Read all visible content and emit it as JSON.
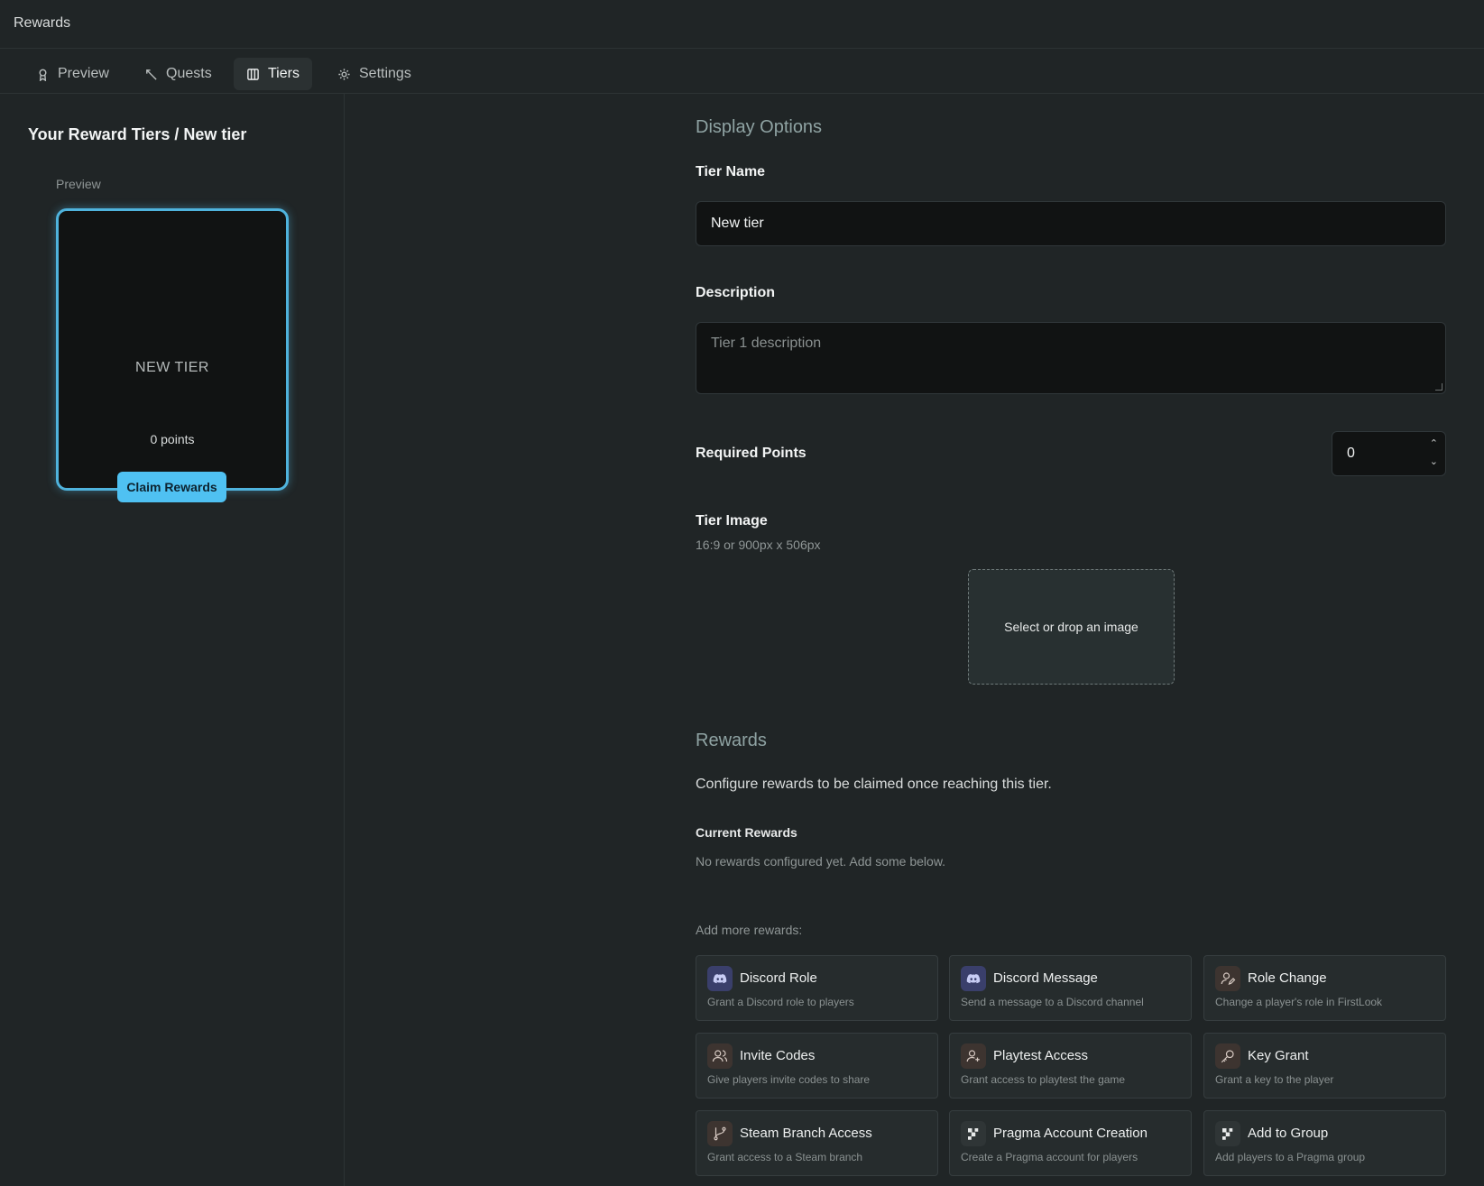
{
  "app": {
    "title": "Rewards"
  },
  "tabs": [
    {
      "label": "Preview",
      "icon": "award-icon",
      "active": false
    },
    {
      "label": "Quests",
      "icon": "wand-icon",
      "active": false
    },
    {
      "label": "Tiers",
      "icon": "columns-icon",
      "active": true
    },
    {
      "label": "Settings",
      "icon": "gear-icon",
      "active": false
    }
  ],
  "sidebar": {
    "breadcrumb": "Your Reward Tiers / New tier",
    "preview_label": "Preview",
    "card": {
      "name": "NEW TIER",
      "points": "0 points",
      "claim_label": "Claim Rewards",
      "accent": "#4fc1f2"
    }
  },
  "form": {
    "display_options_title": "Display Options",
    "tier_name_label": "Tier Name",
    "tier_name_value": "New tier",
    "description_label": "Description",
    "description_placeholder": "Tier 1 description",
    "required_points_label": "Required Points",
    "required_points_value": "0",
    "tier_image_label": "Tier Image",
    "tier_image_hint": "16:9 or 900px x 506px",
    "dropzone_label": "Select or drop an image"
  },
  "rewards": {
    "title": "Rewards",
    "intro": "Configure rewards to be claimed once reaching this tier.",
    "current_label": "Current Rewards",
    "empty_text": "No rewards configured yet. Add some below.",
    "add_more_label": "Add more rewards:",
    "options": [
      {
        "title": "Discord Role",
        "desc": "Grant a Discord role to players",
        "icon": "discord-icon",
        "icon_bg": "#3a3f6b"
      },
      {
        "title": "Discord Message",
        "desc": "Send a message to a Discord channel",
        "icon": "discord-icon",
        "icon_bg": "#3a3f6b"
      },
      {
        "title": "Role Change",
        "desc": "Change a player's role in FirstLook",
        "icon": "user-edit-icon",
        "icon_bg": "#3d3430"
      },
      {
        "title": "Invite Codes",
        "desc": "Give players invite codes to share",
        "icon": "users-icon",
        "icon_bg": "#3d3430"
      },
      {
        "title": "Playtest Access",
        "desc": "Grant access to playtest the game",
        "icon": "user-plus-icon",
        "icon_bg": "#3d3430"
      },
      {
        "title": "Key Grant",
        "desc": "Grant a key to the player",
        "icon": "key-icon",
        "icon_bg": "#3d3430"
      },
      {
        "title": "Steam Branch Access",
        "desc": "Grant access to a Steam branch",
        "icon": "branch-icon",
        "icon_bg": "#3d3430"
      },
      {
        "title": "Pragma Account Creation",
        "desc": "Create a Pragma account for players",
        "icon": "pragma-icon",
        "icon_bg": "#2f3536"
      },
      {
        "title": "Add to Group",
        "desc": "Add players to a Pragma group",
        "icon": "pragma-icon",
        "icon_bg": "#2f3536"
      }
    ]
  }
}
